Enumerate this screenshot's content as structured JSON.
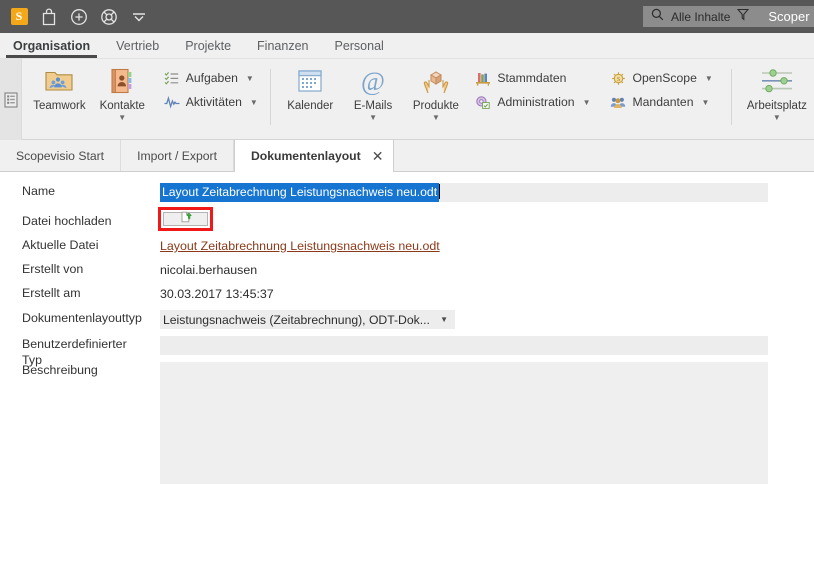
{
  "topbar": {
    "logo_text": "S",
    "icons": [
      {
        "name": "scopevisio-logo",
        "label": "S"
      },
      {
        "name": "shopping-bag-icon",
        "label": "Shop"
      },
      {
        "name": "plus-circle-icon",
        "label": "Neu"
      },
      {
        "name": "lifebuoy-help-icon",
        "label": "Hilfe"
      },
      {
        "name": "chevron-down-icon",
        "label": "Mehr"
      }
    ],
    "search": {
      "placeholder": "Alle Inhalte",
      "filter_icon": "funnel-icon",
      "search_icon": "magnifier-icon"
    },
    "account_label": "Scoper"
  },
  "main_tabs": [
    {
      "label": "Organisation",
      "active": true
    },
    {
      "label": "Vertrieb",
      "active": false
    },
    {
      "label": "Projekte",
      "active": false
    },
    {
      "label": "Finanzen",
      "active": false
    },
    {
      "label": "Personal",
      "active": false
    }
  ],
  "ribbon": {
    "side_toggle_icon": "panel-list-icon",
    "big_buttons": [
      {
        "label": "Teamwork",
        "icon": "folder-people-icon",
        "has_caret": false
      },
      {
        "label": "Kontakte",
        "icon": "address-book-icon",
        "has_caret": true
      },
      {
        "label": "Kalender",
        "icon": "calendar-icon",
        "has_caret": false
      },
      {
        "label": "E-Mails",
        "icon": "at-sign-icon",
        "has_caret": true
      },
      {
        "label": "Produkte",
        "icon": "box-hands-icon",
        "has_caret": true
      },
      {
        "label": "Arbeitsplatz",
        "icon": "sliders-icon",
        "has_caret": true
      }
    ],
    "small_group_1": [
      {
        "label": "Aufgaben",
        "icon": "task-list-icon",
        "has_caret": true
      },
      {
        "label": "Aktivitäten",
        "icon": "activity-pulse-icon",
        "has_caret": true
      }
    ],
    "small_group_2": [
      {
        "label": "Stammdaten",
        "icon": "books-shelf-icon",
        "has_caret": false
      },
      {
        "label": "Administration",
        "icon": "admin-gear-icon",
        "has_caret": true
      }
    ],
    "small_group_3": [
      {
        "label": "OpenScope",
        "icon": "openscope-icon",
        "has_caret": true
      },
      {
        "label": "Mandanten",
        "icon": "clients-people-icon",
        "has_caret": true
      }
    ]
  },
  "doc_tabs": [
    {
      "label": "Scopevisio Start",
      "active": false,
      "closable": false
    },
    {
      "label": "Import / Export",
      "active": false,
      "closable": false
    },
    {
      "label": "Dokumentenlayout",
      "active": true,
      "closable": true,
      "close_glyph": "✕"
    }
  ],
  "form": {
    "name": {
      "label": "Name",
      "value": "Layout Zeitabrechnung Leistungsnachweis neu.odt",
      "selected": true
    },
    "upload": {
      "label": "Datei hochladen",
      "button_icon": "file-upload-icon",
      "highlight_color": "#f01818"
    },
    "current_file": {
      "label": "Aktuelle Datei",
      "value": "Layout Zeitabrechnung Leistungsnachweis neu.odt"
    },
    "created_by": {
      "label": "Erstellt von",
      "value": "nicolai.berhausen"
    },
    "created_at": {
      "label": "Erstellt am",
      "value": "30.03.2017 13:45:37"
    },
    "layout_type": {
      "label": "Dokumentenlayouttyp",
      "value": "Leistungsnachweis (Zeitabrechnung), ODT-Dok...",
      "caret": "▼"
    },
    "custom_type": {
      "label": "Benutzerdefinierter Typ",
      "value": ""
    },
    "description": {
      "label": "Beschreibung",
      "value": ""
    }
  },
  "colors": {
    "topbar_bg": "#575757",
    "ribbon_bg": "#f0f0f0",
    "field_bg": "#ededed",
    "selection_blue": "#1675d1",
    "link_brown": "#8a3a1a",
    "accent_orange": "#f3a81a",
    "highlight_red": "#f01818"
  }
}
